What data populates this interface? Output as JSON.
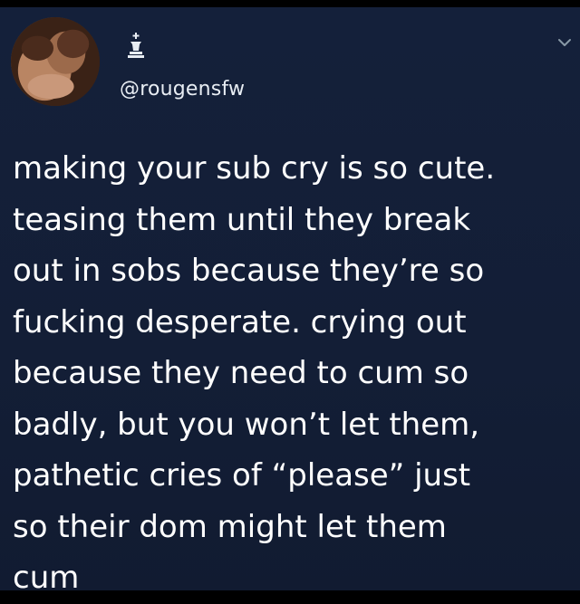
{
  "author": {
    "handle": "@rougensfw"
  },
  "icons": {
    "verified_badge": "chess-king-icon",
    "menu": "chevron-down-icon",
    "avatar": "avatar"
  },
  "tweet": {
    "lines": [
      "making your sub cry is so cute.",
      "teasing them until they break",
      "out in sobs because they’re so",
      "fucking desperate. crying out",
      "because they need to cum so",
      "badly, but you won’t let them,",
      "pathetic cries of “please” just",
      "so their dom might let them",
      "cum"
    ]
  },
  "colors": {
    "background": "#131e36",
    "text": "#ffffff",
    "handle": "#e8edf3",
    "accent": "#8899a6"
  }
}
